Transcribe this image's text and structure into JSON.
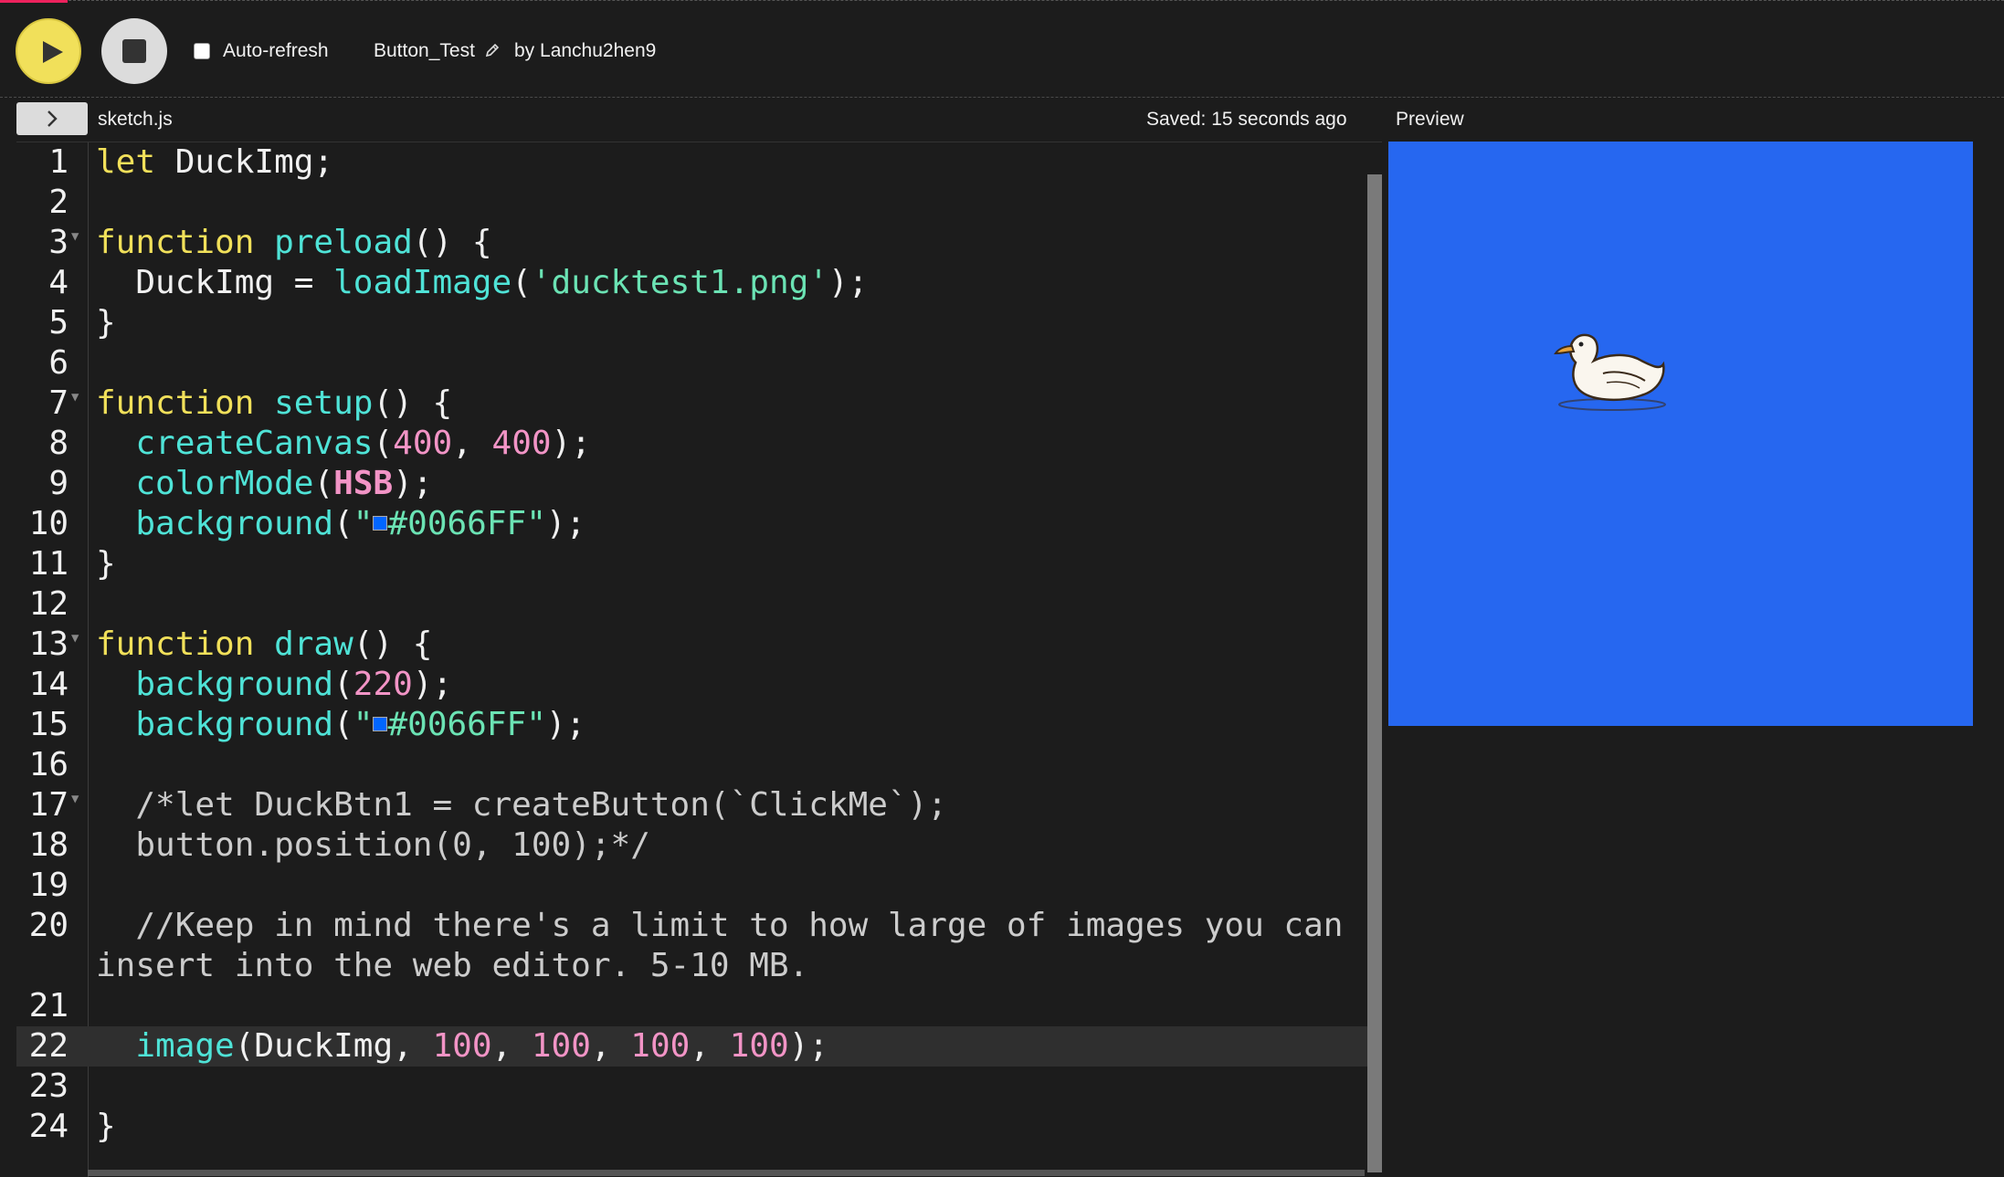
{
  "toolbar": {
    "play_icon": "play-icon",
    "stop_icon": "stop-icon",
    "auto_refresh_label": "Auto-refresh",
    "auto_refresh_checked": false,
    "project_name": "Button_Test",
    "byline": "by Lanchu2hen9"
  },
  "editor": {
    "filename": "sketch.js",
    "saved_status": "Saved: 15 seconds ago",
    "active_line": 22,
    "lines": [
      {
        "num": "1",
        "text": "let DuckImg;"
      },
      {
        "num": "2",
        "text": ""
      },
      {
        "num": "3",
        "text": "function preload() {"
      },
      {
        "num": "4",
        "text": "  DuckImg = loadImage('ducktest1.png');"
      },
      {
        "num": "5",
        "text": "}"
      },
      {
        "num": "6",
        "text": ""
      },
      {
        "num": "7",
        "text": "function setup() {"
      },
      {
        "num": "8",
        "text": "  createCanvas(400, 400);"
      },
      {
        "num": "9",
        "text": "  colorMode(HSB);"
      },
      {
        "num": "10",
        "text": "  background(\"#0066FF\");"
      },
      {
        "num": "11",
        "text": "}"
      },
      {
        "num": "12",
        "text": ""
      },
      {
        "num": "13",
        "text": "function draw() {"
      },
      {
        "num": "14",
        "text": "  background(220);"
      },
      {
        "num": "15",
        "text": "  background(\"#0066FF\");"
      },
      {
        "num": "16",
        "text": ""
      },
      {
        "num": "17",
        "text": "  /*let DuckBtn1 = createButton(`ClickMe`);"
      },
      {
        "num": "18",
        "text": "  button.position(0, 100);*/"
      },
      {
        "num": "19",
        "text": ""
      },
      {
        "num": "20",
        "text": "  //Keep in mind there's a limit to how large of images you can"
      },
      {
        "num": "",
        "text": "insert into the web editor. 5-10 MB."
      },
      {
        "num": "21",
        "text": ""
      },
      {
        "num": "22",
        "text": "  image(DuckImg, 100, 100, 100, 100);"
      },
      {
        "num": "23",
        "text": ""
      },
      {
        "num": "24",
        "text": "}"
      }
    ]
  },
  "preview": {
    "label": "Preview",
    "background_color": "#0066FF",
    "image_icon": "duck-image"
  },
  "colors": {
    "keyword": "#f1e05a",
    "function": "#4fe3d7",
    "string": "#6be3b4",
    "number": "#f294c6",
    "comment": "#cccccc"
  }
}
